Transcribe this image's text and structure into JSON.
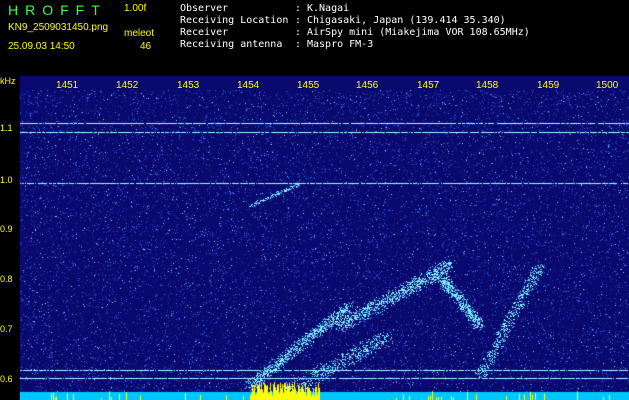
{
  "header": {
    "logo": "HROFFT",
    "version": "1.00f",
    "filename": "KN9_2509031450.png",
    "plugin": "meleot",
    "datetime": "25.09.03 14:50",
    "count": "46",
    "info": [
      {
        "label": "Observer",
        "value": "K.Nagai"
      },
      {
        "label": "Receiving Location",
        "value": "Chigasaki, Japan (139.414 35.340)"
      },
      {
        "label": "Receiver",
        "value": "AirSpy mini (Miakejima VOR 108.65MHz)"
      },
      {
        "label": "Receiving antenna",
        "value": "Maspro FM-3"
      }
    ]
  },
  "plot": {
    "unit": "kHz",
    "x_ticks": [
      "1451",
      "1452",
      "1453",
      "1454",
      "1455",
      "1456",
      "1457",
      "1458",
      "1459",
      "1500"
    ],
    "y_ticks": [
      "1.1",
      "1.0",
      "0.9",
      "0.8",
      "0.7",
      "0.6"
    ],
    "colors": {
      "background": "#0a0a6e",
      "noise": "#3a6cff",
      "signal": "#9fffff",
      "tick": "#ffff00",
      "bar": "#00c8ff",
      "peak": "#ffff00"
    }
  }
}
